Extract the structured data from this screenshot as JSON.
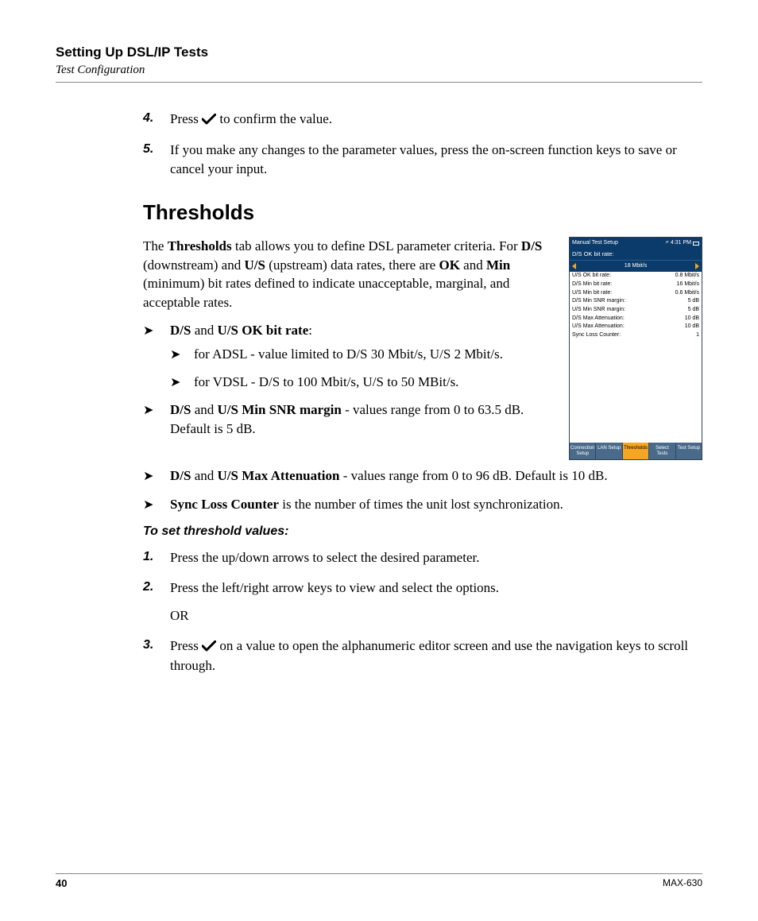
{
  "header": {
    "chapter": "Setting Up DSL/IP Tests",
    "section": "Test Configuration"
  },
  "steps_top": [
    {
      "num": "4.",
      "pre": "Press ",
      "post": " to confirm the value."
    },
    {
      "num": "5.",
      "text": "If you make any changes to the parameter values, press the on-screen function keys to save or cancel your input."
    }
  ],
  "thresholds": {
    "heading": "Thresholds",
    "intro": {
      "t1": "The ",
      "b1": "Thresholds",
      "t2": " tab allows you to define DSL parameter criteria. For ",
      "b2": "D/S",
      "t3": " (downstream) and ",
      "b3": "U/S",
      "t4": " (upstream) data rates, there are ",
      "b4": "OK",
      "t5": " and ",
      "b5": "Min",
      "t6": " (minimum) bit rates defined to indicate unacceptable, marginal, and acceptable rates."
    },
    "bullets": {
      "bitrate": {
        "b1": "D/S",
        "t1": " and ",
        "b2": "U/S OK bit rate",
        "t2": ":"
      },
      "bitrate_sub": [
        "for ADSL - value limited to D/S 30 Mbit/s, U/S 2 Mbit/s.",
        "for VDSL - D/S to 100 Mbit/s, U/S to 50 MBit/s."
      ],
      "snr": {
        "b1": "D/S",
        "t1": " and ",
        "b2": "U/S Min SNR margin",
        "t2": " - values range from 0 to 63.5 dB. Default is 5 dB."
      },
      "atten": {
        "b1": "D/S",
        "t1": " and ",
        "b2": "U/S Max Attenuation",
        "t2": " - values range from 0 to 96 dB. Default is 10 dB."
      },
      "sync": {
        "b1": "Sync Loss Counter",
        "t1": " is the number of times the unit lost synchronization."
      }
    },
    "subheading": "To set threshold values:",
    "steps_bottom": [
      {
        "num": "1.",
        "text": "Press the up/down arrows to select the desired parameter."
      },
      {
        "num": "2.",
        "text": "Press the left/right arrow keys to view and select the options.",
        "or": "OR"
      },
      {
        "num": "3.",
        "pre": "Press ",
        "post": " on a value to open the alphanumeric editor screen and use the navigation keys to scroll through."
      }
    ]
  },
  "device": {
    "top_title": "Manual Test Setup",
    "top_time": "4:31 PM",
    "param_label": "D/S OK bit rate:",
    "param_value": "18 Mbit/s",
    "rows": [
      {
        "label": "U/S OK bit rate:",
        "value": "0.8 Mbit/s"
      },
      {
        "label": "D/S Min bit rate:",
        "value": "16 Mbit/s"
      },
      {
        "label": "U/S Min bit rate:",
        "value": "0.6 Mbit/s"
      },
      {
        "label": "D/S Min SNR margin:",
        "value": "5 dB"
      },
      {
        "label": "U/S Min SNR margin:",
        "value": "5 dB"
      },
      {
        "label": "D/S Max Attenuation:",
        "value": "10 dB"
      },
      {
        "label": "U/S Max Attenuation:",
        "value": "10 dB"
      },
      {
        "label": "Sync Loss Counter:",
        "value": "1"
      }
    ],
    "tabs": [
      "Connection Setup",
      "LAN Setup",
      "Thresholds",
      "Select Tests",
      "Test Setup"
    ],
    "active_tab": 2
  },
  "footer": {
    "page": "40",
    "model": "MAX-630"
  }
}
